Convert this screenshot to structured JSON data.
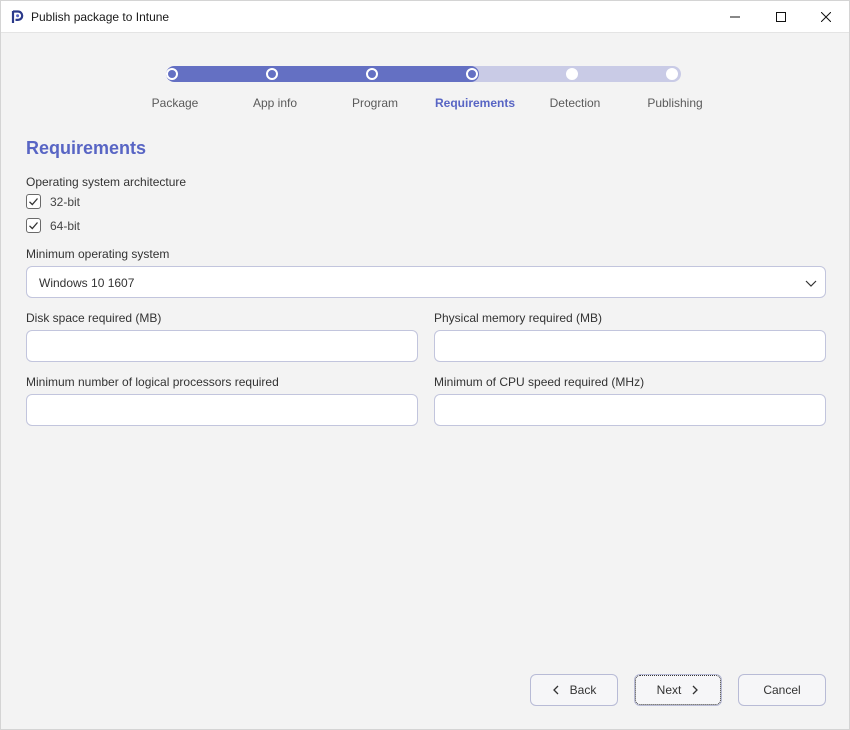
{
  "window": {
    "title": "Publish package to Intune"
  },
  "stepper": {
    "steps": [
      {
        "label": "Package",
        "state": "done"
      },
      {
        "label": "App info",
        "state": "done"
      },
      {
        "label": "Program",
        "state": "done"
      },
      {
        "label": "Requirements",
        "state": "active"
      },
      {
        "label": "Detection",
        "state": "todo"
      },
      {
        "label": "Publishing",
        "state": "todo"
      }
    ]
  },
  "page": {
    "title": "Requirements"
  },
  "architecture": {
    "label": "Operating system architecture",
    "options": [
      {
        "label": "32-bit",
        "checked": true
      },
      {
        "label": "64-bit",
        "checked": true
      }
    ]
  },
  "min_os": {
    "label": "Minimum operating system",
    "value": "Windows 10 1607"
  },
  "disk_space": {
    "label": "Disk space required (MB)",
    "value": ""
  },
  "physical_memory": {
    "label": "Physical memory required (MB)",
    "value": ""
  },
  "logical_processors": {
    "label": "Minimum number of logical processors required",
    "value": ""
  },
  "cpu_speed": {
    "label": "Minimum of CPU speed required (MHz)",
    "value": ""
  },
  "buttons": {
    "back": "Back",
    "next": "Next",
    "cancel": "Cancel"
  },
  "colors": {
    "accent": "#5865c4",
    "stepper_done": "#6470c3",
    "stepper_todo": "#c9cbe6"
  }
}
